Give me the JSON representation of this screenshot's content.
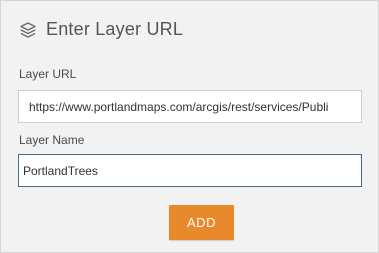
{
  "panel": {
    "title": "Enter Layer URL",
    "header_icon": "layers-icon"
  },
  "form": {
    "url_label": "Layer URL",
    "url_value": "https://www.portlandmaps.com/arcgis/rest/services/Publi",
    "name_label": "Layer Name",
    "name_value": "PortlandTrees",
    "submit_label": "ADD"
  },
  "colors": {
    "panel_bg": "#f2f2f2",
    "accent_button": "#e8892c",
    "focus_border": "#4a6b8a"
  }
}
